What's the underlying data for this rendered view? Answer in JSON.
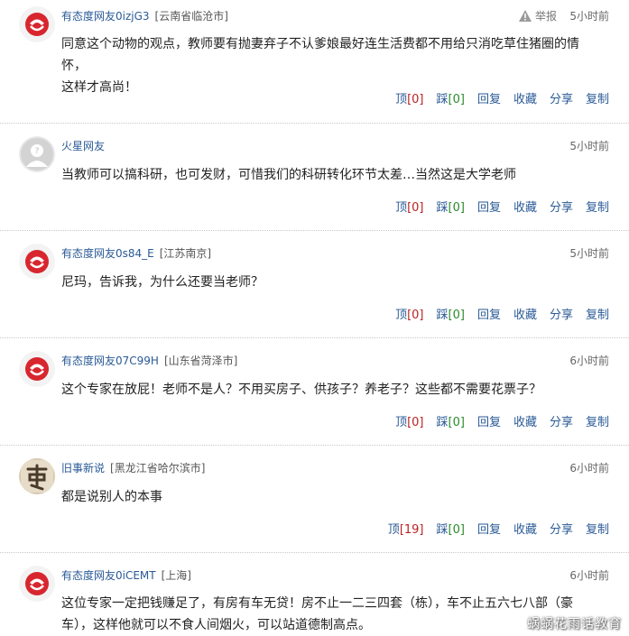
{
  "colors": {
    "link": "#2a5a96",
    "up_count": "#b22222",
    "down_count": "#2a8a2a",
    "divider": "#c9c9c9"
  },
  "labels": {
    "up": "顶",
    "down": "踩",
    "reply": "回复",
    "collect": "收藏",
    "share": "分享",
    "copy": "复制",
    "report": "举报"
  },
  "comments": [
    {
      "user": "有态度网友0izjG3",
      "location": "[云南省临沧市]",
      "time": "5小时前",
      "avatar": "ifeng-logo",
      "text_lines": [
        "同意这个动物的观点，教师要有抛妻弃子不认爹娘最好连生活费都不用给只消吃草住猪圈的情怀，",
        "这样才高尚！"
      ],
      "up": "[0]",
      "down": "[0]",
      "show_report": true
    },
    {
      "user": "火星网友",
      "location": "",
      "time": "5小时前",
      "avatar": "default-user",
      "text_lines": [
        "当教师可以搞科研，也可发财，可惜我们的科研转化环节太差…当然这是大学老师"
      ],
      "up": "[0]",
      "down": "[0]"
    },
    {
      "user": "有态度网友0s84_E",
      "location": "[江苏南京]",
      "time": "5小时前",
      "avatar": "ifeng-logo",
      "text_lines": [
        "尼玛，告诉我，为什么还要当老师？"
      ],
      "up": "[0]",
      "down": "[0]"
    },
    {
      "user": "有态度网友07C99H",
      "location": "[山东省菏泽市]",
      "time": "6小时前",
      "avatar": "ifeng-logo",
      "text_lines": [
        "这个专家在放屁！老师不是人？不用买房子、供孩子？养老子？这些都不需要花票子？"
      ],
      "up": "[0]",
      "down": "[0]"
    },
    {
      "user": "旧事新说",
      "location": "[黑龙江省哈尔滨市]",
      "time": "6小时前",
      "avatar": "calligraphy",
      "text_lines": [
        "都是说别人的本事"
      ],
      "up": "[19]",
      "down": "[0]"
    },
    {
      "user": "有态度网友0iCEMT",
      "location": "[上海]",
      "time": "6小时前",
      "avatar": "ifeng-logo",
      "text_lines": [
        "这位专家一定把钱赚足了，有房有车无贷！房不止一二三四套（栋），车不止五六七八部（豪",
        "车），这样他就可以不食人间烟火，可以站道德制高点。"
      ]
    }
  ],
  "watermark": "蜗蜗花雨话教育"
}
